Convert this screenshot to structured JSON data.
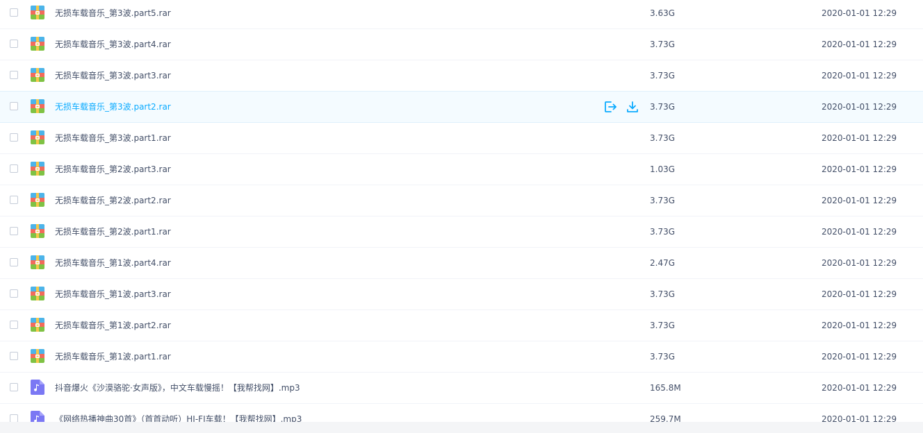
{
  "files": [
    {
      "name": "无损车载音乐_第3波.part5.rar",
      "size": "3.63G",
      "time": "2020-01-01 12:29",
      "icon": "rar-archive-icon"
    },
    {
      "name": "无损车载音乐_第3波.part4.rar",
      "size": "3.73G",
      "time": "2020-01-01 12:29",
      "icon": "rar-archive-icon"
    },
    {
      "name": "无损车载音乐_第3波.part3.rar",
      "size": "3.73G",
      "time": "2020-01-01 12:29",
      "icon": "rar-archive-icon"
    },
    {
      "name": "无损车载音乐_第3波.part2.rar",
      "size": "3.73G",
      "time": "2020-01-01 12:29",
      "icon": "rar-archive-icon",
      "hovered": true
    },
    {
      "name": "无损车载音乐_第3波.part1.rar",
      "size": "3.73G",
      "time": "2020-01-01 12:29",
      "icon": "rar-archive-icon"
    },
    {
      "name": "无损车载音乐_第2波.part3.rar",
      "size": "1.03G",
      "time": "2020-01-01 12:29",
      "icon": "rar-archive-icon"
    },
    {
      "name": "无损车载音乐_第2波.part2.rar",
      "size": "3.73G",
      "time": "2020-01-01 12:29",
      "icon": "rar-archive-icon"
    },
    {
      "name": "无损车载音乐_第2波.part1.rar",
      "size": "3.73G",
      "time": "2020-01-01 12:29",
      "icon": "rar-archive-icon"
    },
    {
      "name": "无损车载音乐_第1波.part4.rar",
      "size": "2.47G",
      "time": "2020-01-01 12:29",
      "icon": "rar-archive-icon"
    },
    {
      "name": "无损车载音乐_第1波.part3.rar",
      "size": "3.73G",
      "time": "2020-01-01 12:29",
      "icon": "rar-archive-icon"
    },
    {
      "name": "无损车载音乐_第1波.part2.rar",
      "size": "3.73G",
      "time": "2020-01-01 12:29",
      "icon": "rar-archive-icon"
    },
    {
      "name": "无损车载音乐_第1波.part1.rar",
      "size": "3.73G",
      "time": "2020-01-01 12:29",
      "icon": "rar-archive-icon"
    },
    {
      "name": "抖音爆火《沙漠骆驼·女声版》，中文车载慢摇！【我帮找网】.mp3",
      "size": "165.8M",
      "time": "2020-01-01 12:29",
      "icon": "music-file-icon"
    },
    {
      "name": "《网络热播神曲30首》（首首动听）HI-FI车载！【我帮找网】.mp3",
      "size": "259.7M",
      "time": "2020-01-01 12:29",
      "icon": "music-file-icon"
    }
  ],
  "row_actions": {
    "share_icon": "share-export-icon",
    "download_icon": "download-icon"
  },
  "colors": {
    "accent": "#09aaff",
    "text": "#424e67",
    "hover_bg": "#f4fbff",
    "music_icon": "#7b78f4"
  }
}
